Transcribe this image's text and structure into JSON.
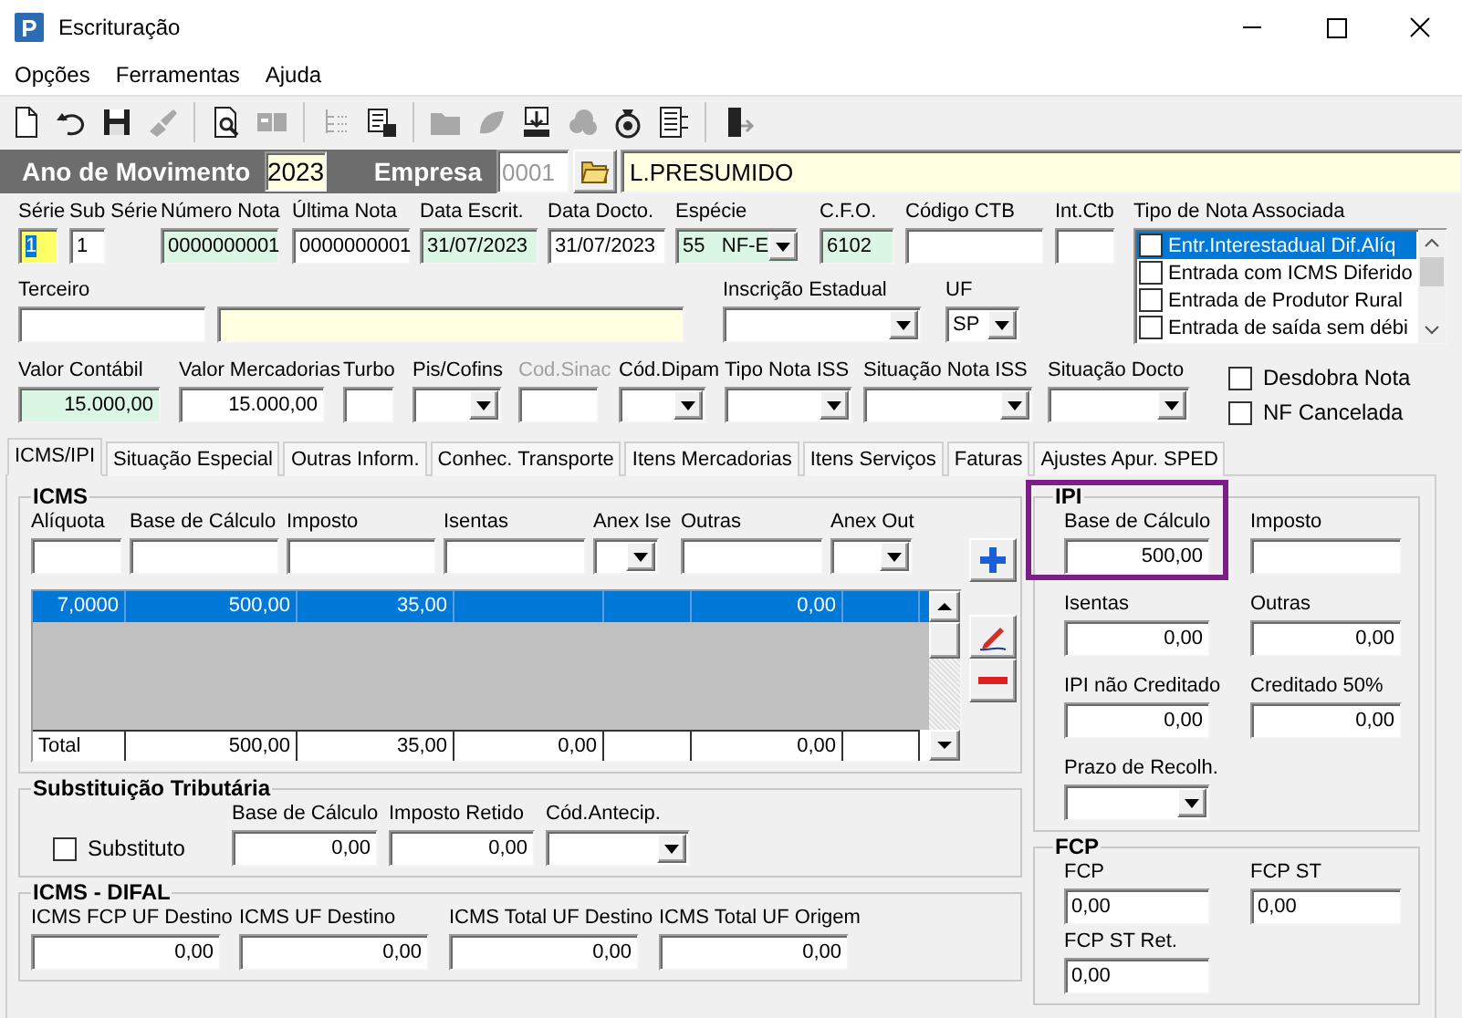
{
  "window": {
    "title": "Escrituração",
    "icon_letter": "P"
  },
  "menu": [
    {
      "label": "Opções"
    },
    {
      "label": "Ferramentas"
    },
    {
      "label": "Ajuda"
    }
  ],
  "toolbar": [
    {
      "kind": "new",
      "disabled": false
    },
    {
      "kind": "undo",
      "disabled": false
    },
    {
      "kind": "save",
      "disabled": false
    },
    {
      "kind": "brush",
      "disabled": true
    },
    {
      "kind": "separator"
    },
    {
      "kind": "preview",
      "disabled": false
    },
    {
      "kind": "nfe",
      "disabled": true
    },
    {
      "kind": "separator"
    },
    {
      "kind": "tree",
      "disabled": true
    },
    {
      "kind": "stamp",
      "disabled": false
    },
    {
      "kind": "separator"
    },
    {
      "kind": "folder",
      "disabled": true
    },
    {
      "kind": "blob",
      "disabled": true
    },
    {
      "kind": "download",
      "disabled": false
    },
    {
      "kind": "cloud",
      "disabled": true
    },
    {
      "kind": "coins",
      "disabled": false
    },
    {
      "kind": "list",
      "disabled": false
    },
    {
      "kind": "separator"
    },
    {
      "kind": "exit",
      "disabled": false
    }
  ],
  "header": {
    "year_label": "Ano de Movimento",
    "year": "2023",
    "company_label": "Empresa",
    "company_code": "0001",
    "company_name": "L.PRESUMIDO"
  },
  "row1": [
    {
      "label": "Série",
      "value": "1",
      "kind": "text",
      "color": "#ffff66",
      "focused": true
    },
    {
      "label": "Sub Série",
      "value": "1",
      "kind": "text",
      "color": "#ffffff"
    },
    {
      "label": "Número Nota",
      "value": "0000000001",
      "kind": "text",
      "color": "#dcf6e6"
    },
    {
      "label": "Última Nota",
      "value": "0000000001",
      "kind": "text",
      "color": "#ffffff"
    },
    {
      "label": "Data Escrit.",
      "value": "31/07/2023",
      "kind": "text",
      "color": "#dcf6e6"
    },
    {
      "label": "Data Docto.",
      "value": "31/07/2023",
      "kind": "text",
      "color": "#ffffff"
    },
    {
      "label": "Espécie",
      "value": "55   NF-E",
      "kind": "select",
      "color": "#dcf6e6"
    },
    {
      "label": "C.F.O.",
      "value": "6102",
      "kind": "text",
      "color": "#dcf6e6"
    },
    {
      "label": "Código CTB",
      "kind": "text",
      "color": "#ffffff"
    },
    {
      "label": "Int.Ctb",
      "kind": "text",
      "color": "#ffffff"
    }
  ],
  "row2": [
    {
      "label": "Terceiro",
      "kind": "text",
      "color": "#ffffff"
    },
    {
      "kind": "text",
      "color": "#ffffe1"
    },
    {
      "label": "Inscrição Estadual",
      "kind": "select",
      "color": "#ffffff"
    },
    {
      "label": "UF",
      "value": "SP",
      "kind": "select",
      "color": "#ffffff"
    }
  ],
  "associated_notes": {
    "label": "Tipo de Nota Associada",
    "items": [
      {
        "label": "Entr.Interestadual Dif.Alíq",
        "checked": false,
        "selected": true
      },
      {
        "label": "Entrada com ICMS Diferido",
        "checked": false,
        "selected": false
      },
      {
        "label": "Entrada de Produtor Rural",
        "checked": false,
        "selected": false
      },
      {
        "label": "Entrada de saída sem débi",
        "checked": false,
        "selected": false
      }
    ]
  },
  "row3": [
    {
      "label": "Valor Contábil",
      "value": "15.000,00",
      "kind": "number",
      "color": "#dcf6e6",
      "disabled": false
    },
    {
      "label": "Valor Mercadorias",
      "value": "15.000,00",
      "kind": "number",
      "color": "#ffffff",
      "disabled": false
    },
    {
      "label": "Turbo",
      "kind": "text",
      "color": "#ffffff",
      "disabled": false
    },
    {
      "label": "Pis/Cofins",
      "kind": "select",
      "color": "#ffffff",
      "disabled": false
    },
    {
      "label": "Cod.Sinac",
      "kind": "text",
      "color": "#ffffff",
      "disabled": true
    },
    {
      "label": "Cód.Dipam",
      "kind": "select",
      "color": "#ffffff",
      "disabled": false
    },
    {
      "label": "Tipo Nota ISS",
      "kind": "select",
      "color": "#ffffff",
      "disabled": false
    },
    {
      "label": "Situação Nota ISS",
      "kind": "select",
      "color": "#ffffff",
      "disabled": false
    },
    {
      "label": "Situação Docto",
      "kind": "select",
      "color": "#ffffff",
      "disabled": false
    }
  ],
  "flags": [
    {
      "label": "Desdobra Nota",
      "checked": false
    },
    {
      "label": "NF Cancelada",
      "checked": false
    }
  ],
  "tabs": [
    {
      "label": "ICMS/IPI",
      "selected": true
    },
    {
      "label": "Situação Especial",
      "selected": false
    },
    {
      "label": "Outras Inform.",
      "selected": false
    },
    {
      "label": "Conhec. Transporte",
      "selected": false
    },
    {
      "label": "Itens Mercadorias",
      "selected": false
    },
    {
      "label": "Itens Serviços",
      "selected": false
    },
    {
      "label": "Faturas",
      "selected": false
    },
    {
      "label": "Ajustes Apur. SPED",
      "selected": false
    }
  ],
  "icms": {
    "title": "ICMS",
    "inputs": [
      {
        "label": "Alíquota",
        "kind": "text"
      },
      {
        "label": "Base de Cálculo",
        "kind": "text"
      },
      {
        "label": "Imposto",
        "kind": "text"
      },
      {
        "label": "Isentas",
        "kind": "text"
      },
      {
        "label": "Anex Ise",
        "kind": "select"
      },
      {
        "label": "Outras",
        "kind": "text"
      },
      {
        "label": "Anex Out",
        "kind": "select"
      }
    ],
    "rows": [
      {
        "aliquota": "7,0000",
        "base": "500,00",
        "imposto": "35,00",
        "outras": "0,00",
        "selected": true
      }
    ],
    "total": {
      "label": "Total",
      "base": "500,00",
      "imposto": "35,00",
      "isentas": "0,00",
      "outras": "0,00"
    }
  },
  "substitution": {
    "title": "Substituição Tributária",
    "checkbox": {
      "label": "Substituto",
      "checked": false
    },
    "fields": [
      {
        "label": "Base de Cálculo",
        "value": "0,00",
        "kind": "number"
      },
      {
        "label": "Imposto Retido",
        "value": "0,00",
        "kind": "number"
      },
      {
        "label": "Cód.Antecip.",
        "kind": "select"
      }
    ]
  },
  "difal": {
    "title": "ICMS - DIFAL",
    "fields": [
      {
        "label": "ICMS FCP UF Destino",
        "value": "0,00",
        "kind": "number"
      },
      {
        "label": "ICMS UF Destino",
        "value": "0,00",
        "kind": "number"
      },
      {
        "label": "ICMS Total UF Destino",
        "value": "0,00",
        "kind": "number"
      },
      {
        "label": "ICMS Total UF Origem",
        "value": "0,00",
        "kind": "number"
      }
    ]
  },
  "ipi": {
    "title": "IPI",
    "rows": [
      [
        {
          "label": "Base de Cálculo",
          "value": "500,00",
          "kind": "number",
          "highlighted": true
        },
        {
          "label": "Imposto",
          "kind": "number",
          "highlighted": false
        }
      ],
      [
        {
          "label": "Isentas",
          "value": "0,00",
          "kind": "number",
          "highlighted": false
        },
        {
          "label": "Outras",
          "value": "0,00",
          "kind": "number",
          "highlighted": false
        }
      ],
      [
        {
          "label": "IPI não Creditado",
          "value": "0,00",
          "kind": "number",
          "highlighted": false
        },
        {
          "label": "Creditado 50%",
          "value": "0,00",
          "kind": "number",
          "highlighted": false
        }
      ],
      [
        {
          "label": "Prazo de Recolh.",
          "kind": "select",
          "highlighted": false
        }
      ]
    ]
  },
  "fcp": {
    "title": "FCP",
    "fields": [
      {
        "label": "FCP",
        "value": "0,00",
        "kind": "text"
      },
      {
        "label": "FCP ST",
        "value": "0,00",
        "kind": "text"
      },
      {
        "label": "FCP ST Ret.",
        "value": "0,00",
        "kind": "text"
      }
    ]
  }
}
